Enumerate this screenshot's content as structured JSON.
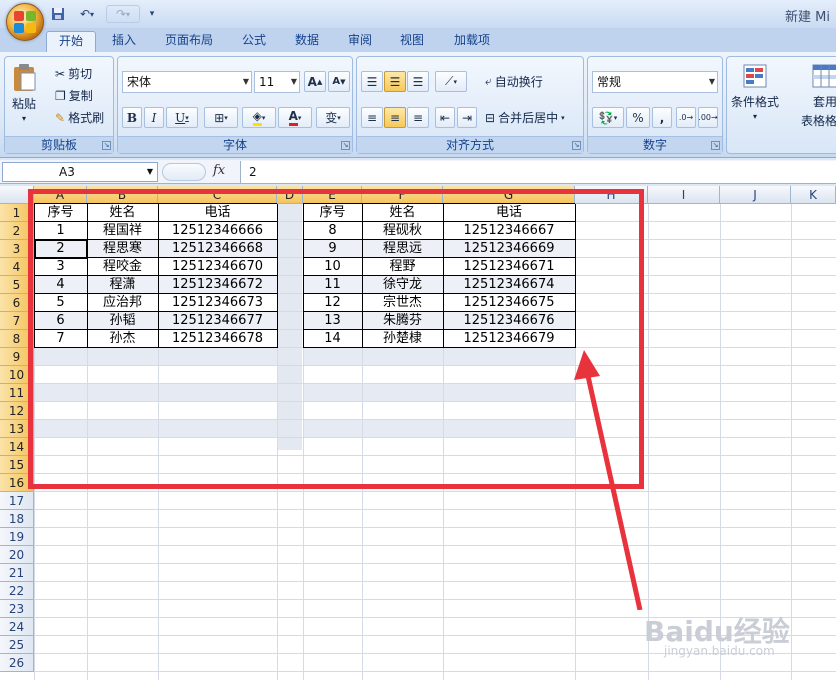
{
  "window": {
    "title": "新建 Mi"
  },
  "tabs": [
    "开始",
    "插入",
    "页面布局",
    "公式",
    "数据",
    "审阅",
    "视图",
    "加载项"
  ],
  "ribbon": {
    "clipboard": {
      "paste": "粘贴",
      "cut": "剪切",
      "copy": "复制",
      "format_painter": "格式刷",
      "label": "剪贴板"
    },
    "font": {
      "name": "宋体",
      "size": "11",
      "bold": "B",
      "italic": "I",
      "underline": "U",
      "label": "字体",
      "grow": "A",
      "shrink": "A",
      "wen": "变"
    },
    "alignment": {
      "wrap": "自动换行",
      "merge": "合并后居中",
      "label": "对齐方式"
    },
    "number": {
      "format": "常规",
      "percent": "%",
      "comma": ",",
      "label": "数字"
    },
    "styles": {
      "conditional": "条件格式",
      "table": "套用",
      "table2": "表格格式"
    }
  },
  "formula_bar": {
    "name_box": "A3",
    "fx": "fx",
    "value": "2"
  },
  "columns": [
    "A",
    "B",
    "C",
    "D",
    "E",
    "F",
    "G",
    "H",
    "I",
    "J",
    "K"
  ],
  "rows": [
    "1",
    "2",
    "3",
    "4",
    "5",
    "6",
    "7",
    "8",
    "9",
    "10",
    "11",
    "12",
    "13",
    "14",
    "15",
    "16",
    "17",
    "18",
    "19",
    "20",
    "21",
    "22",
    "23",
    "24",
    "25",
    "26"
  ],
  "table_left": {
    "headers": [
      "序号",
      "姓名",
      "电话"
    ],
    "rows": [
      [
        "1",
        "程国祥",
        "12512346666"
      ],
      [
        "2",
        "程思寒",
        "12512346668"
      ],
      [
        "3",
        "程咬金",
        "12512346670"
      ],
      [
        "4",
        "程潇",
        "12512346672"
      ],
      [
        "5",
        "应治邦",
        "12512346673"
      ],
      [
        "6",
        "孙韬",
        "12512346677"
      ],
      [
        "7",
        "孙杰",
        "12512346678"
      ]
    ]
  },
  "table_right": {
    "headers": [
      "序号",
      "姓名",
      "电话"
    ],
    "rows": [
      [
        "8",
        "程砚秋",
        "12512346667"
      ],
      [
        "9",
        "程思远",
        "12512346669"
      ],
      [
        "10",
        "程野",
        "12512346671"
      ],
      [
        "11",
        "徐守龙",
        "12512346674"
      ],
      [
        "12",
        "宗世杰",
        "12512346675"
      ],
      [
        "13",
        "朱腾芬",
        "12512346676"
      ],
      [
        "14",
        "孙楚棣",
        "12512346679"
      ]
    ]
  },
  "watermark": {
    "brand": "Baidu经验",
    "url": "jingyan.baidu.com"
  },
  "colors": {
    "annotation": "#e8323c",
    "selected_header": "#f5c35b",
    "band": "#e6eaf3"
  }
}
